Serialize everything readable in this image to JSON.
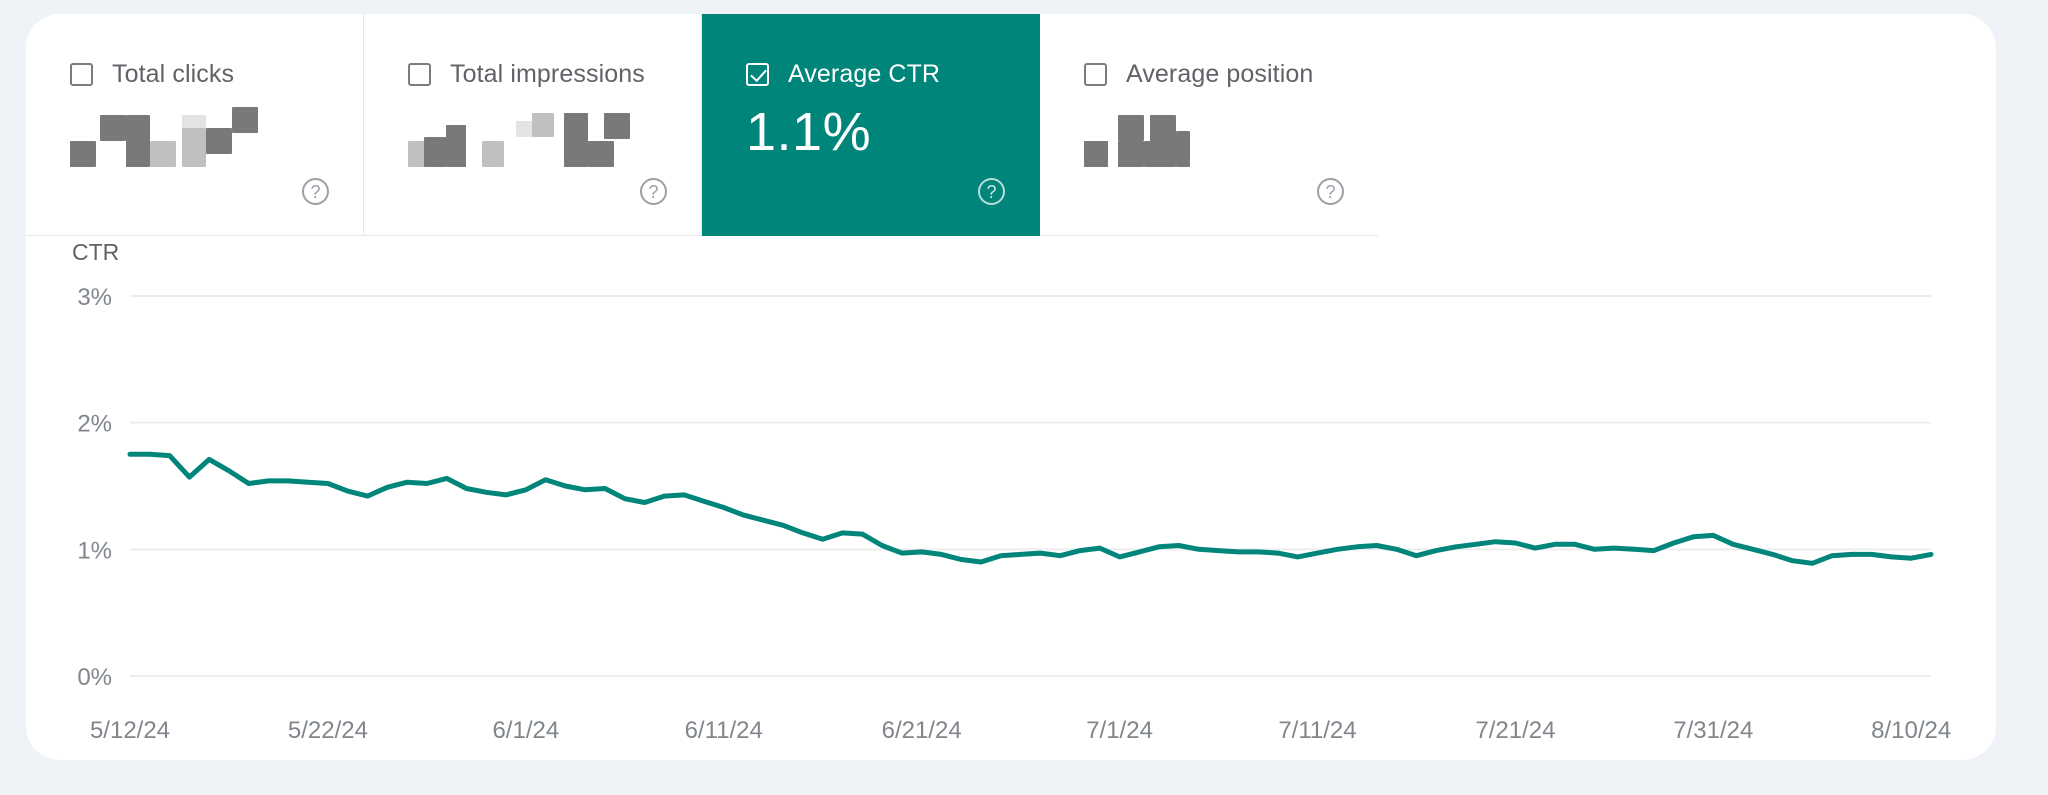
{
  "theme": {
    "page_background": "#eff2f7",
    "card_background": "#ffffff",
    "accent": "#00857a",
    "line_color": "#00857a",
    "grid_color": "#eceded",
    "text_muted": "#5f6368"
  },
  "metrics": [
    {
      "label": "Total clicks",
      "value": "",
      "value_state": "redacted",
      "selected": false,
      "checked": false,
      "help_icon": "help-circle-icon"
    },
    {
      "label": "Total impressions",
      "value": "",
      "value_state": "redacted",
      "selected": false,
      "checked": false,
      "help_icon": "help-circle-icon"
    },
    {
      "label": "Average CTR",
      "value": "1.1%",
      "value_state": "visible",
      "selected": true,
      "checked": true,
      "help_icon": "help-circle-icon"
    },
    {
      "label": "Average position",
      "value": "",
      "value_state": "redacted",
      "selected": false,
      "checked": false,
      "help_icon": "help-circle-icon"
    }
  ],
  "chart_data": {
    "type": "line",
    "title": "",
    "ylabel": "CTR",
    "xlabel": "",
    "ylim": [
      0,
      3
    ],
    "y_ticks": [
      3,
      2,
      1,
      0
    ],
    "y_tick_labels": [
      "3%",
      "2%",
      "1%",
      "0%"
    ],
    "grid": true,
    "legend_position": "none",
    "x_tick_labels": [
      "5/12/24",
      "5/22/24",
      "6/1/24",
      "6/11/24",
      "6/21/24",
      "7/1/24",
      "7/11/24",
      "7/21/24",
      "7/31/24",
      "8/10/24"
    ],
    "x_start": "5/12/24",
    "x_end": "8/10/24",
    "series": [
      {
        "name": "CTR",
        "unit": "%",
        "values": [
          1.75,
          1.75,
          1.74,
          1.57,
          1.71,
          1.62,
          1.52,
          1.54,
          1.54,
          1.53,
          1.52,
          1.46,
          1.42,
          1.49,
          1.53,
          1.52,
          1.56,
          1.48,
          1.45,
          1.43,
          1.47,
          1.55,
          1.5,
          1.47,
          1.48,
          1.4,
          1.37,
          1.42,
          1.43,
          1.38,
          1.33,
          1.27,
          1.23,
          1.19,
          1.13,
          1.08,
          1.13,
          1.12,
          1.03,
          0.97,
          0.98,
          0.96,
          0.92,
          0.9,
          0.95,
          0.96,
          0.97,
          0.95,
          0.99,
          1.01,
          0.94,
          0.98,
          1.02,
          1.03,
          1.0,
          0.99,
          0.98,
          0.98,
          0.97,
          0.94,
          0.97,
          1.0,
          1.02,
          1.03,
          1.0,
          0.95,
          0.99,
          1.02,
          1.04,
          1.06,
          1.05,
          1.01,
          1.04,
          1.04,
          1.0,
          1.01,
          1.0,
          0.99,
          1.05,
          1.1,
          1.11,
          1.04,
          1.0,
          0.96,
          0.91,
          0.89,
          0.95,
          0.96,
          0.96,
          0.94,
          0.93,
          0.96
        ]
      }
    ]
  }
}
